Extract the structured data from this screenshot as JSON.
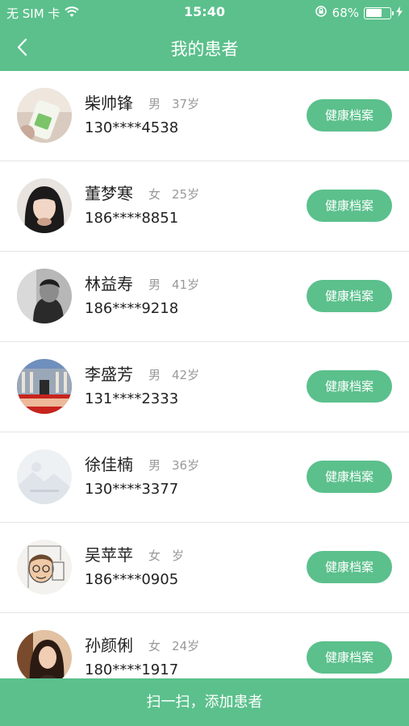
{
  "status": {
    "carrier": "无 SIM 卡",
    "time": "15:40",
    "battery": "68%",
    "battery_level": 0.68
  },
  "nav": {
    "title": "我的患者"
  },
  "patients": [
    {
      "name": "柴帅锋",
      "gender": "男",
      "age": "37岁",
      "phone": "130****4538",
      "action": "健康档案"
    },
    {
      "name": "董梦寒",
      "gender": "女",
      "age": "25岁",
      "phone": "186****8851",
      "action": "健康档案"
    },
    {
      "name": "林益寿",
      "gender": "男",
      "age": "41岁",
      "phone": "186****9218",
      "action": "健康档案"
    },
    {
      "name": "李盛芳",
      "gender": "男",
      "age": "42岁",
      "phone": "131****2333",
      "action": "健康档案"
    },
    {
      "name": "徐佳楠",
      "gender": "男",
      "age": "36岁",
      "phone": "130****3377",
      "action": "健康档案"
    },
    {
      "name": "吴苹苹",
      "gender": "女",
      "age": "岁",
      "phone": "186****0905",
      "action": "健康档案"
    },
    {
      "name": "孙颜俐",
      "gender": "女",
      "age": "24岁",
      "phone": "180****1917",
      "action": "健康档案"
    }
  ],
  "bottom": {
    "label": "扫一扫，添加患者"
  }
}
